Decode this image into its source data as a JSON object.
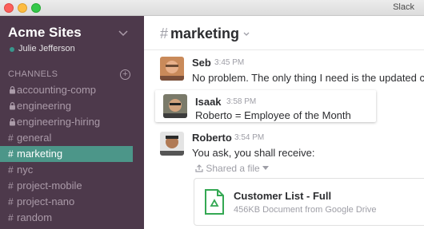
{
  "window": {
    "app_title": "Slack"
  },
  "sidebar": {
    "team_name": "Acme Sites",
    "user_name": "Julie Jefferson",
    "channels_header": "CHANNELS",
    "add_icon": "plus-circle-icon",
    "channels": [
      {
        "name": "accounting-comp",
        "private": true,
        "active": false
      },
      {
        "name": "engineering",
        "private": true,
        "active": false
      },
      {
        "name": "engineering-hiring",
        "private": true,
        "active": false
      },
      {
        "name": "general",
        "private": false,
        "active": false
      },
      {
        "name": "marketing",
        "private": false,
        "active": true
      },
      {
        "name": "nyc",
        "private": false,
        "active": false
      },
      {
        "name": "project-mobile",
        "private": false,
        "active": false
      },
      {
        "name": "project-nano",
        "private": false,
        "active": false
      },
      {
        "name": "random",
        "private": false,
        "active": false
      }
    ]
  },
  "channel_header": {
    "hash": "#",
    "name": "marketing"
  },
  "messages": [
    {
      "author": "Seb",
      "time": "3:45 PM",
      "text": "No problem. The only thing I need is the updated client"
    },
    {
      "author": "Isaak",
      "time": "3:58 PM",
      "text": "Roberto = Employee of the Month"
    },
    {
      "author": "Roberto",
      "time": "3:54 PM",
      "text": "You ask, you shall receive:"
    }
  ],
  "shared": {
    "label": "Shared a file",
    "file_name": "Customer List - Full",
    "file_meta": "456KB Document from Google Drive"
  },
  "colors": {
    "sidebar_bg": "#4d394b",
    "active_channel": "#4c9689",
    "presence": "#38978d"
  }
}
